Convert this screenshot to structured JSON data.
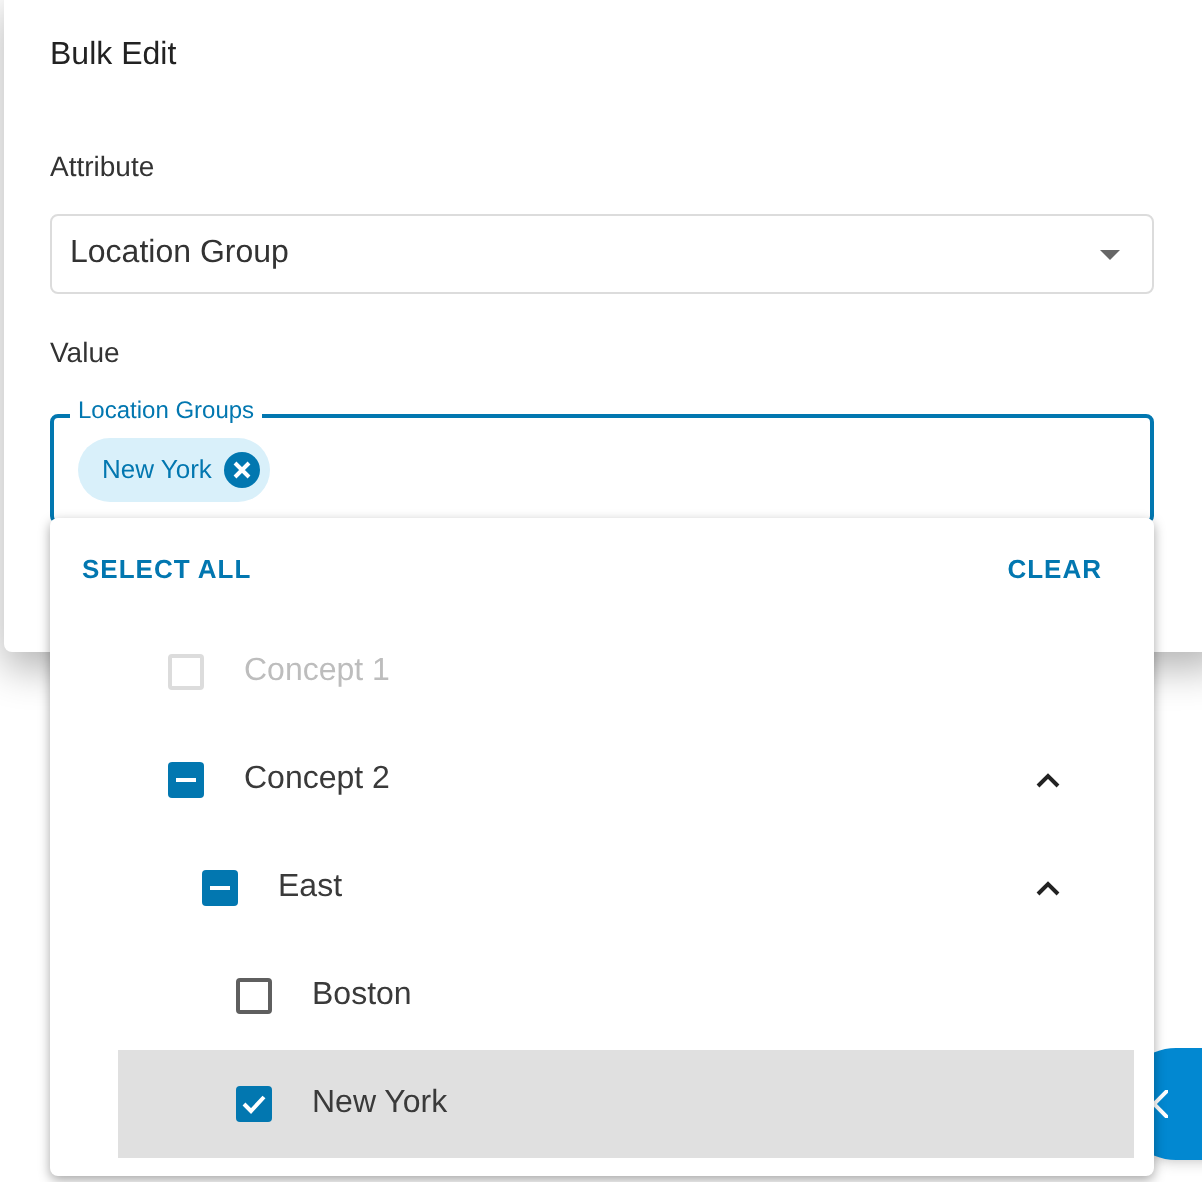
{
  "dialog": {
    "title": "Bulk Edit",
    "attribute_label": "Attribute",
    "attribute_value": "Location Group",
    "value_label": "Value",
    "field_label": "Location Groups",
    "chips": [
      {
        "label": "New York"
      }
    ]
  },
  "dropdown": {
    "select_all": "SELECT ALL",
    "clear": "CLEAR",
    "items": [
      {
        "label": "Concept 1",
        "checked": false,
        "indeterminate": false,
        "disabled": true,
        "selected": false
      },
      {
        "label": "Concept 2",
        "checked": false,
        "indeterminate": true,
        "disabled": false,
        "selected": false,
        "expanded": true,
        "children": [
          {
            "label": "East",
            "checked": false,
            "indeterminate": true,
            "disabled": false,
            "selected": false,
            "expanded": true,
            "children": [
              {
                "label": "Boston",
                "checked": false,
                "indeterminate": false,
                "disabled": false,
                "selected": false
              },
              {
                "label": "New York",
                "checked": true,
                "indeterminate": false,
                "disabled": false,
                "selected": true
              }
            ]
          }
        ]
      }
    ]
  }
}
